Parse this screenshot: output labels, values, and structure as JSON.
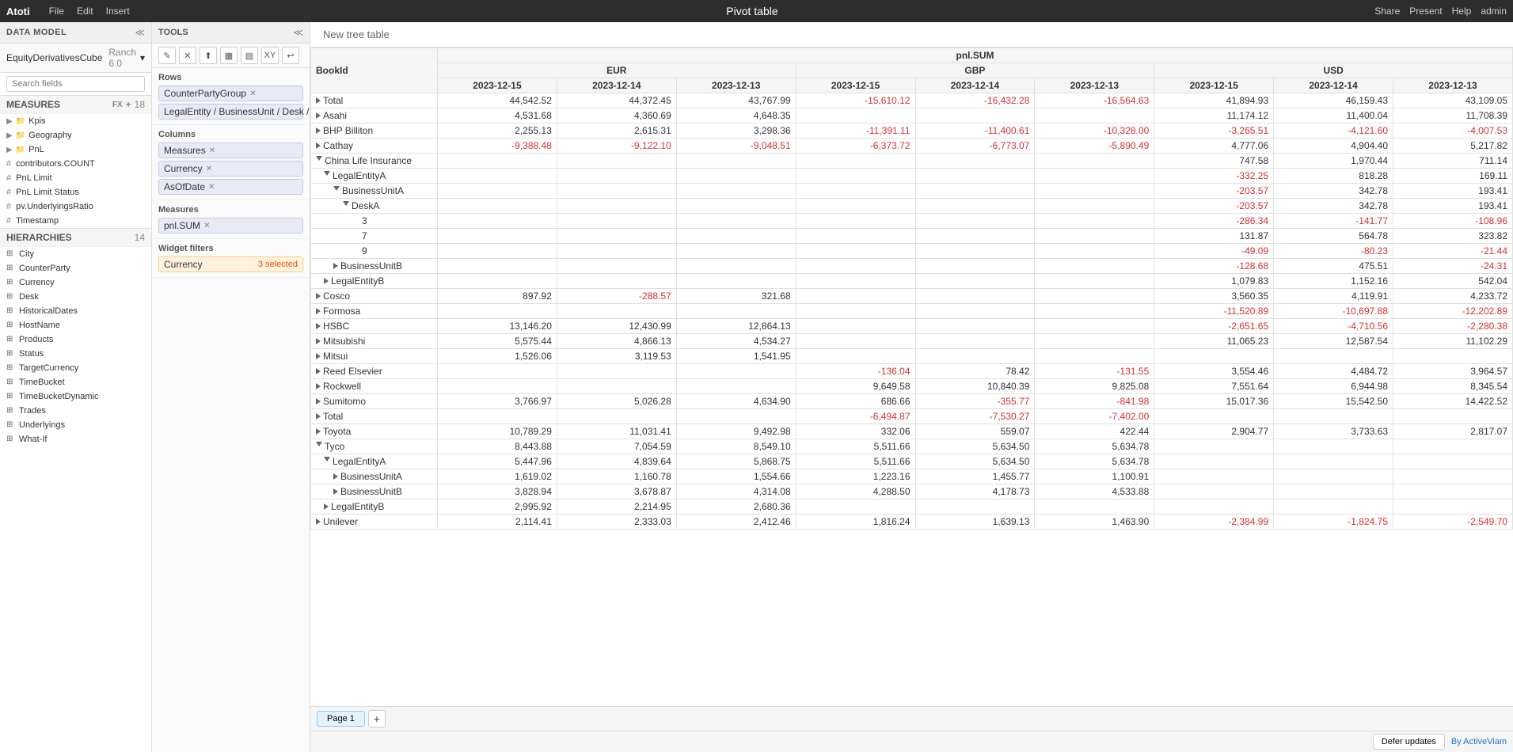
{
  "app": {
    "brand": "Atoti",
    "menu_items": [
      "File",
      "Edit",
      "Insert"
    ],
    "title": "Pivot table",
    "right_actions": [
      "Share",
      "Present",
      "Help",
      "admin"
    ]
  },
  "data_model": {
    "label": "DATA MODEL",
    "cube": "EquityDerivativesCube",
    "version": "Ranch 6.0",
    "search_placeholder": "Search fields",
    "measures_label": "MEASURES",
    "measures_count": "18",
    "measures": [
      {
        "type": "folder",
        "name": "Kpis"
      },
      {
        "type": "folder",
        "name": "Geography"
      },
      {
        "type": "folder",
        "name": "PnL"
      },
      {
        "type": "hash",
        "name": "contributors.COUNT"
      },
      {
        "type": "hash",
        "name": "PnL Limit"
      },
      {
        "type": "hash",
        "name": "PnL Limit Status"
      },
      {
        "type": "hash",
        "name": "pv.UnderlyingsRatio"
      },
      {
        "type": "hash",
        "name": "Timestamp"
      }
    ],
    "hierarchies_label": "HIERARCHIES",
    "hierarchies_count": "14",
    "hierarchies": [
      "City",
      "CounterParty",
      "Currency",
      "Desk",
      "HistoricalDates",
      "HostName",
      "Products",
      "Status",
      "TargetCurrency",
      "TimeBucket",
      "TimeBucketDynamic",
      "Trades",
      "Underlyings",
      "What-If"
    ]
  },
  "tools": {
    "label": "TOOLS",
    "toolbar_buttons": [
      "✎",
      "✕",
      "⬆",
      "▦",
      "▤",
      "XY",
      "↩"
    ],
    "rows_label": "Rows",
    "rows_pills": [
      "CounterPartyGroup",
      "LegalEntity / BusinessUnit / Desk / B..."
    ],
    "columns_label": "Columns",
    "columns_pills": [
      "Measures",
      "Currency",
      "AsOfDate"
    ],
    "measures_label": "Measures",
    "measures_pills": [
      "pnl.SUM"
    ],
    "widget_filters_label": "Widget filters",
    "currency_filter": "Currency",
    "currency_filter_count": "3 selected"
  },
  "table": {
    "new_tree_label": "New tree table",
    "col_book_id": "BookId",
    "col_pnl_sum": "pnl.SUM",
    "currencies": [
      "EUR",
      "GBP",
      "USD"
    ],
    "dates": [
      "2023-12-15",
      "2023-12-14",
      "2023-12-13"
    ],
    "rows": [
      {
        "label": "Total",
        "indent": 0,
        "expand": false,
        "eur_15": "44,542.52",
        "eur_14": "44,372.45",
        "eur_13": "43,767.99",
        "gbp_15": "-15,610.12",
        "gbp_14": "-16,432.28",
        "gbp_13": "-16,564.63",
        "usd_15": "41,894.93",
        "usd_14": "46,159.43",
        "usd_13": "43,109.05"
      },
      {
        "label": "Asahi",
        "indent": 0,
        "expand": false,
        "eur_15": "4,531.68",
        "eur_14": "4,360.69",
        "eur_13": "4,648.35",
        "gbp_15": "",
        "gbp_14": "",
        "gbp_13": "",
        "usd_15": "11,174.12",
        "usd_14": "11,400.04",
        "usd_13": "11,708.39"
      },
      {
        "label": "BHP Billiton",
        "indent": 0,
        "expand": false,
        "eur_15": "2,255.13",
        "eur_14": "2,615.31",
        "eur_13": "3,298.36",
        "gbp_15": "-11,391.11",
        "gbp_14": "-11,400.61",
        "gbp_13": "-10,328.00",
        "usd_15": "-3,265.51",
        "usd_14": "-4,121.60",
        "usd_13": "-4,007.53"
      },
      {
        "label": "Cathay",
        "indent": 0,
        "expand": false,
        "eur_15": "-9,388.48",
        "eur_14": "-9,122.10",
        "eur_13": "-9,048.51",
        "gbp_15": "-6,373.72",
        "gbp_14": "-6,773.07",
        "gbp_13": "-5,890.49",
        "usd_15": "4,777.06",
        "usd_14": "4,904.40",
        "usd_13": "5,217.82"
      },
      {
        "label": "China Life Insurance",
        "indent": 0,
        "expand": true,
        "eur_15": "",
        "eur_14": "",
        "eur_13": "",
        "gbp_15": "",
        "gbp_14": "",
        "gbp_13": "",
        "usd_15": "747.58",
        "usd_14": "1,970.44",
        "usd_13": "711.14"
      },
      {
        "label": "LegalEntityA",
        "indent": 1,
        "expand": true,
        "eur_15": "",
        "eur_14": "",
        "eur_13": "",
        "gbp_15": "",
        "gbp_14": "",
        "gbp_13": "",
        "usd_15": "-332.25",
        "usd_14": "818.28",
        "usd_13": "169.11"
      },
      {
        "label": "BusinessUnitA",
        "indent": 2,
        "expand": true,
        "eur_15": "",
        "eur_14": "",
        "eur_13": "",
        "gbp_15": "",
        "gbp_14": "",
        "gbp_13": "",
        "usd_15": "-203.57",
        "usd_14": "342.78",
        "usd_13": "193.41"
      },
      {
        "label": "DeskA",
        "indent": 3,
        "expand": true,
        "eur_15": "",
        "eur_14": "",
        "eur_13": "",
        "gbp_15": "",
        "gbp_14": "",
        "gbp_13": "",
        "usd_15": "-203.57",
        "usd_14": "342.78",
        "usd_13": "193.41"
      },
      {
        "label": "3",
        "indent": 4,
        "expand": false,
        "eur_15": "",
        "eur_14": "",
        "eur_13": "",
        "gbp_15": "",
        "gbp_14": "",
        "gbp_13": "",
        "usd_15": "-286.34",
        "usd_14": "-141.77",
        "usd_13": "-108.96"
      },
      {
        "label": "7",
        "indent": 4,
        "expand": false,
        "eur_15": "",
        "eur_14": "",
        "eur_13": "",
        "gbp_15": "",
        "gbp_14": "",
        "gbp_13": "",
        "usd_15": "131.87",
        "usd_14": "564.78",
        "usd_13": "323.82"
      },
      {
        "label": "9",
        "indent": 4,
        "expand": false,
        "eur_15": "",
        "eur_14": "",
        "eur_13": "",
        "gbp_15": "",
        "gbp_14": "",
        "gbp_13": "",
        "usd_15": "-49.09",
        "usd_14": "-80.23",
        "usd_13": "-21.44"
      },
      {
        "label": "BusinessUnitB",
        "indent": 2,
        "expand": false,
        "eur_15": "",
        "eur_14": "",
        "eur_13": "",
        "gbp_15": "",
        "gbp_14": "",
        "gbp_13": "",
        "usd_15": "-128.68",
        "usd_14": "475.51",
        "usd_13": "-24.31"
      },
      {
        "label": "LegalEntityB",
        "indent": 1,
        "expand": false,
        "eur_15": "",
        "eur_14": "",
        "eur_13": "",
        "gbp_15": "",
        "gbp_14": "",
        "gbp_13": "",
        "usd_15": "1,079.83",
        "usd_14": "1,152.16",
        "usd_13": "542.04"
      },
      {
        "label": "Cosco",
        "indent": 0,
        "expand": false,
        "eur_15": "897.92",
        "eur_14": "-288.57",
        "eur_13": "321.68",
        "gbp_15": "",
        "gbp_14": "",
        "gbp_13": "",
        "usd_15": "3,560.35",
        "usd_14": "4,119.91",
        "usd_13": "4,233.72"
      },
      {
        "label": "Formosa",
        "indent": 0,
        "expand": false,
        "eur_15": "",
        "eur_14": "",
        "eur_13": "",
        "gbp_15": "",
        "gbp_14": "",
        "gbp_13": "",
        "usd_15": "-11,520.89",
        "usd_14": "-10,697.88",
        "usd_13": "-12,202.89"
      },
      {
        "label": "HSBC",
        "indent": 0,
        "expand": false,
        "eur_15": "13,146.20",
        "eur_14": "12,430.99",
        "eur_13": "12,864.13",
        "gbp_15": "",
        "gbp_14": "",
        "gbp_13": "",
        "usd_15": "-2,651.65",
        "usd_14": "-4,710.56",
        "usd_13": "-2,280.38"
      },
      {
        "label": "Mitsubishi",
        "indent": 0,
        "expand": false,
        "eur_15": "5,575.44",
        "eur_14": "4,866.13",
        "eur_13": "4,534.27",
        "gbp_15": "",
        "gbp_14": "",
        "gbp_13": "",
        "usd_15": "11,065.23",
        "usd_14": "12,587.54",
        "usd_13": "11,102.29"
      },
      {
        "label": "Mitsui",
        "indent": 0,
        "expand": false,
        "eur_15": "1,526.06",
        "eur_14": "3,119.53",
        "eur_13": "1,541.95",
        "gbp_15": "",
        "gbp_14": "",
        "gbp_13": "",
        "usd_15": "",
        "usd_14": "",
        "usd_13": ""
      },
      {
        "label": "Reed Elsevier",
        "indent": 0,
        "expand": false,
        "eur_15": "",
        "eur_14": "",
        "eur_13": "",
        "gbp_15": "-136.04",
        "gbp_14": "78.42",
        "gbp_13": "-131.55",
        "usd_15": "3,554.46",
        "usd_14": "4,484.72",
        "usd_13": "3,964.57"
      },
      {
        "label": "Rockwell",
        "indent": 0,
        "expand": false,
        "eur_15": "",
        "eur_14": "",
        "eur_13": "",
        "gbp_15": "9,649.58",
        "gbp_14": "10,840.39",
        "gbp_13": "9,825.08",
        "usd_15": "7,551.64",
        "usd_14": "6,944.98",
        "usd_13": "8,345.54"
      },
      {
        "label": "Sumitomo",
        "indent": 0,
        "expand": false,
        "eur_15": "3,766.97",
        "eur_14": "5,026.28",
        "eur_13": "4,634.90",
        "gbp_15": "686.66",
        "gbp_14": "-355.77",
        "gbp_13": "-841.98",
        "usd_15": "15,017.36",
        "usd_14": "15,542.50",
        "usd_13": "14,422.52"
      },
      {
        "label": "Total",
        "indent": 0,
        "expand": false,
        "eur_15": "",
        "eur_14": "",
        "eur_13": "",
        "gbp_15": "-6,494.87",
        "gbp_14": "-7,530.27",
        "gbp_13": "-7,402.00",
        "usd_15": "",
        "usd_14": "",
        "usd_13": ""
      },
      {
        "label": "Toyota",
        "indent": 0,
        "expand": false,
        "eur_15": "10,789.29",
        "eur_14": "11,031.41",
        "eur_13": "9,492.98",
        "gbp_15": "332.06",
        "gbp_14": "559.07",
        "gbp_13": "422.44",
        "usd_15": "2,904.77",
        "usd_14": "3,733.63",
        "usd_13": "2,817.07"
      },
      {
        "label": "Tyco",
        "indent": 0,
        "expand": true,
        "eur_15": "8,443.88",
        "eur_14": "7,054.59",
        "eur_13": "8,549.10",
        "gbp_15": "5,511.66",
        "gbp_14": "5,634.50",
        "gbp_13": "5,634.78",
        "usd_15": "",
        "usd_14": "",
        "usd_13": ""
      },
      {
        "label": "LegalEntityA",
        "indent": 1,
        "expand": true,
        "eur_15": "5,447.96",
        "eur_14": "4,839.64",
        "eur_13": "5,868.75",
        "gbp_15": "5,511.66",
        "gbp_14": "5,634.50",
        "gbp_13": "5,634.78",
        "usd_15": "",
        "usd_14": "",
        "usd_13": ""
      },
      {
        "label": "BusinessUnitA",
        "indent": 2,
        "expand": false,
        "eur_15": "1,619.02",
        "eur_14": "1,160.78",
        "eur_13": "1,554.66",
        "gbp_15": "1,223.16",
        "gbp_14": "1,455.77",
        "gbp_13": "1,100.91",
        "usd_15": "",
        "usd_14": "",
        "usd_13": ""
      },
      {
        "label": "BusinessUnitB",
        "indent": 2,
        "expand": false,
        "eur_15": "3,828.94",
        "eur_14": "3,678.87",
        "eur_13": "4,314.08",
        "gbp_15": "4,288.50",
        "gbp_14": "4,178.73",
        "gbp_13": "4,533.88",
        "usd_15": "",
        "usd_14": "",
        "usd_13": ""
      },
      {
        "label": "LegalEntityB",
        "indent": 1,
        "expand": false,
        "eur_15": "2,995.92",
        "eur_14": "2,214.95",
        "eur_13": "2,680.36",
        "gbp_15": "",
        "gbp_14": "",
        "gbp_13": "",
        "usd_15": "",
        "usd_14": "",
        "usd_13": ""
      },
      {
        "label": "Unilever",
        "indent": 0,
        "expand": false,
        "eur_15": "2,114.41",
        "eur_14": "2,333.03",
        "eur_13": "2,412.46",
        "gbp_15": "1,816.24",
        "gbp_14": "1,639.13",
        "gbp_13": "1,463.90",
        "usd_15": "-2,384.99",
        "usd_14": "-1,824.75",
        "usd_13": "-2,549.70"
      }
    ]
  },
  "footer": {
    "page_tab": "Page 1",
    "defer_updates": "Defer updates",
    "by_active_viam": "By ActiveViam"
  }
}
